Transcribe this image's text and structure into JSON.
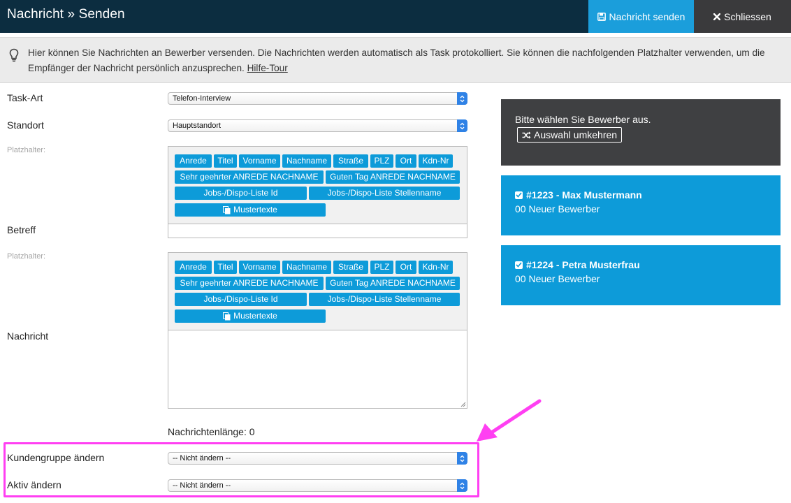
{
  "header": {
    "title": "Nachricht » Senden",
    "send_label": "Nachricht senden",
    "close_label": "Schliessen"
  },
  "info": {
    "text": "Hier können Sie Nachrichten an Bewerber versenden. Die Nachrichten werden automatisch als Task protokolliert. Sie können die nachfolgenden Platzhalter verwenden, um die Empfänger der Nachricht persönlich anzusprechen.",
    "link": "Hilfe-Tour"
  },
  "form": {
    "task_art_label": "Task-Art",
    "task_art_value": "Telefon-Interview",
    "standort_label": "Standort",
    "standort_value": "Hauptstandort",
    "platzhalter_label": "Platzhalter:",
    "betreff_label": "Betreff",
    "nachricht_label": "Nachricht",
    "length_text": "Nachrichtenlänge: 0",
    "kundengruppe_label": "Kundengruppe ändern",
    "kundengruppe_value": "-- Nicht ändern --",
    "aktiv_label": "Aktiv ändern",
    "aktiv_value": "-- Nicht ändern --"
  },
  "placeholders": {
    "row1": [
      "Anrede",
      "Titel",
      "Vorname",
      "Nachname",
      "Straße",
      "PLZ",
      "Ort",
      "Kdn-Nr"
    ],
    "row2": [
      "Sehr geehrter ANREDE NACHNAME",
      "Guten Tag ANREDE NACHNAME"
    ],
    "row3": [
      "Jobs-/Dispo-Liste Id",
      "Jobs-/Dispo-Liste Stellenname"
    ],
    "mustertexte": "Mustertexte"
  },
  "recipients": {
    "prompt": "Bitte wählen Sie Bewerber aus.",
    "invert_label": "Auswahl umkehren",
    "items": [
      {
        "name": "#1223 - Max Mustermann",
        "status": "00 Neuer Bewerber"
      },
      {
        "name": "#1224 - Petra Musterfrau",
        "status": "00 Neuer Bewerber"
      }
    ]
  },
  "colors": {
    "header_bg": "#0c2d40",
    "accent": "#1b9edb",
    "highlight": "#ff3ff2"
  }
}
